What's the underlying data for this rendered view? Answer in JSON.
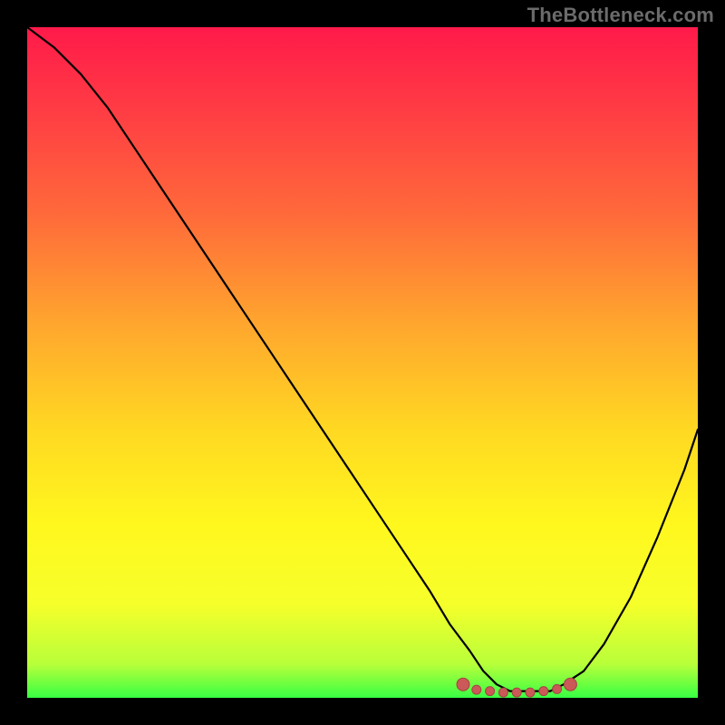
{
  "watermark": "TheBottleneck.com",
  "colors": {
    "background": "#000000",
    "gradient_stops": [
      "#ff1a4a",
      "#ff3b44",
      "#ff6a3a",
      "#ffa52e",
      "#ffd822",
      "#fff71e",
      "#f6ff2a",
      "#b8ff3a",
      "#37ff44"
    ],
    "curve_stroke": "#000000",
    "marker_fill": "#cb5957",
    "marker_stroke": "#a24442"
  },
  "chart_data": {
    "type": "line",
    "title": "",
    "xlabel": "",
    "ylabel": "",
    "xlim": [
      0,
      100
    ],
    "ylim": [
      0,
      100
    ],
    "series": [
      {
        "name": "bottleneck-curve",
        "x": [
          0,
          4,
          8,
          12,
          16,
          20,
          24,
          28,
          32,
          36,
          40,
          44,
          48,
          52,
          56,
          60,
          63,
          66,
          68,
          70,
          72,
          74,
          76,
          78,
          80,
          83,
          86,
          90,
          94,
          98,
          100
        ],
        "y": [
          100,
          97,
          93,
          88,
          82,
          76,
          70,
          64,
          58,
          52,
          46,
          40,
          34,
          28,
          22,
          16,
          11,
          7,
          4,
          2,
          1,
          1,
          1,
          1,
          2,
          4,
          8,
          15,
          24,
          34,
          40
        ]
      }
    ],
    "markers": {
      "name": "optimal-range",
      "x": [
        65,
        67,
        69,
        71,
        73,
        75,
        77,
        79,
        81
      ],
      "y": [
        2,
        1.2,
        1,
        0.8,
        0.8,
        0.8,
        1,
        1.3,
        2
      ]
    },
    "green_band_y": [
      0,
      2.5
    ]
  }
}
